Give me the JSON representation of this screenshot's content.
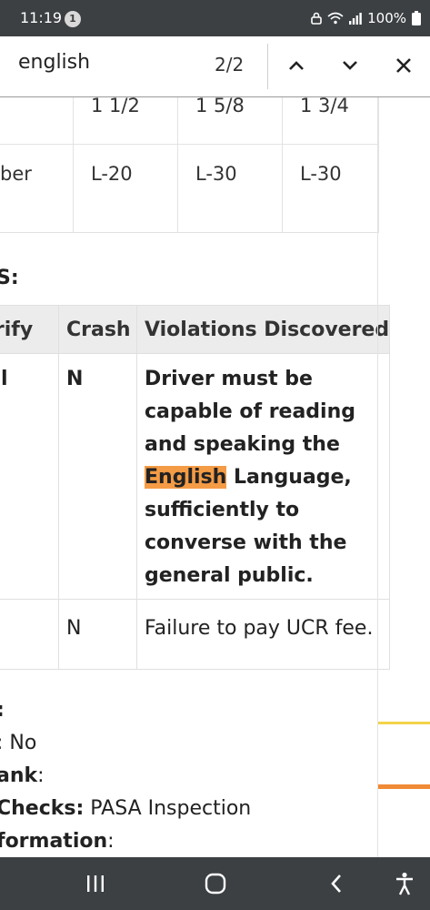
{
  "status_bar": {
    "time": "11:19",
    "notification_count": "1",
    "battery": "100%"
  },
  "find_bar": {
    "query": "english",
    "match_count": "2/2"
  },
  "table_top": {
    "rows": [
      [
        "",
        "1 1/2",
        "1 5/8",
        "1 3/4"
      ],
      [
        "ber",
        "L-20",
        "L-30",
        "L-30"
      ]
    ]
  },
  "section_heading": "S:",
  "violations_table": {
    "headers": [
      "erify",
      "Crash",
      "Violations Discovered"
    ],
    "rows": [
      {
        "verify": "l",
        "crash": "N",
        "desc_before": "Driver must be capable of reading and speaking the ",
        "desc_highlight": "English",
        "desc_after": " Language, sufficiently to converse with the general public."
      },
      {
        "verify": "",
        "crash": "N",
        "desc": "Failure to pay UCR fee."
      }
    ]
  },
  "info": {
    "line1_label": ":",
    "line2_value": ": No",
    "line3_label": "ank",
    "line3_suffix": ":",
    "line4_label": " Checks:",
    "line4_value": " PASA Inspection",
    "line5_label": "formation",
    "line5_suffix": ":"
  },
  "colors": {
    "status_bg": "#3c4043",
    "highlight": "#f49b45",
    "scroll_marker_current": "#f08a35",
    "scroll_marker": "#f2d44a"
  }
}
